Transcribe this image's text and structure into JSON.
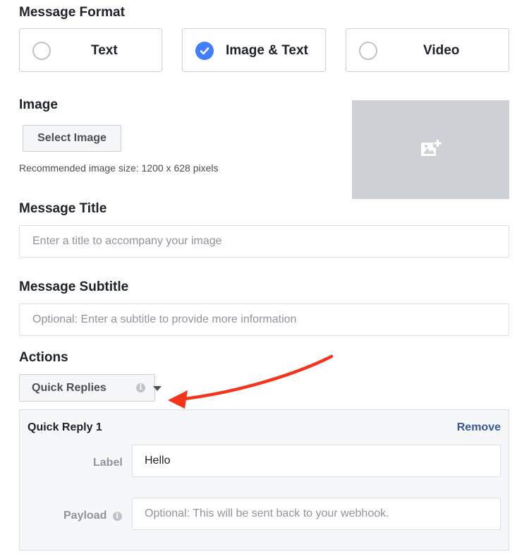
{
  "message_format": {
    "title": "Message Format",
    "options": [
      {
        "label": "Text",
        "checked": false
      },
      {
        "label": "Image & Text",
        "checked": true
      },
      {
        "label": "Video",
        "checked": false
      }
    ]
  },
  "image": {
    "title": "Image",
    "select_button": "Select Image",
    "hint": "Recommended image size: 1200 x 628 pixels",
    "placeholder_icon": "add-image-icon"
  },
  "message_title": {
    "title": "Message Title",
    "placeholder": "Enter a title to accompany your image",
    "value": ""
  },
  "message_subtitle": {
    "title": "Message Subtitle",
    "placeholder": "Optional: Enter a subtitle to provide more information",
    "value": ""
  },
  "actions": {
    "title": "Actions",
    "dropdown_value": "Quick Replies",
    "info_icon": "info-icon",
    "caret_icon": "caret-down-icon"
  },
  "quick_reply": {
    "title": "Quick Reply 1",
    "remove_label": "Remove",
    "label_field": {
      "label": "Label",
      "value": "Hello"
    },
    "payload_field": {
      "label": "Payload",
      "placeholder": "Optional: This will be sent back to your webhook.",
      "value": ""
    }
  },
  "colors": {
    "accent": "#4080ff",
    "link": "#365899",
    "annotation_arrow": "#f5341c",
    "placeholder_bg": "#cdd0d4"
  }
}
